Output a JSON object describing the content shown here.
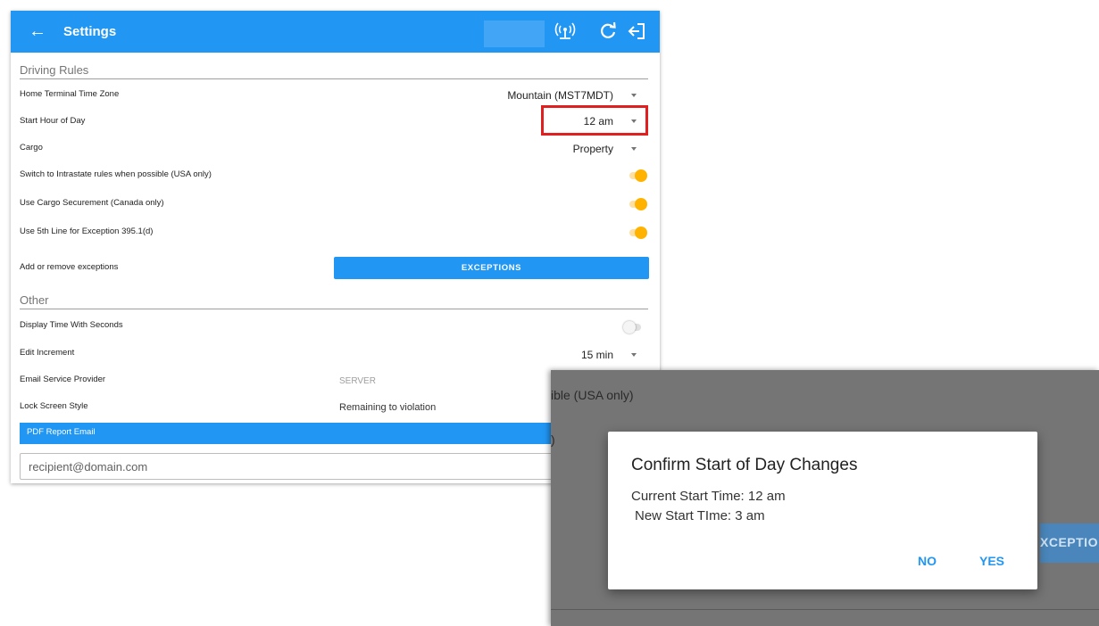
{
  "header": {
    "back_icon": "arrow-left-icon",
    "title": "Settings",
    "icons": [
      "antenna-icon",
      "refresh-icon",
      "logout-icon"
    ],
    "accent": "#2196f3"
  },
  "driving_rules": {
    "section_title": "Driving Rules",
    "home_terminal": {
      "label": "Home Terminal Time Zone",
      "value": "Mountain (MST7MDT)"
    },
    "start_hour": {
      "label": "Start Hour of Day",
      "value": "12 am"
    },
    "cargo": {
      "label": "Cargo",
      "value": "Property"
    },
    "intrastate": {
      "label": "Switch to Intrastate rules when possible (USA only)",
      "on": true
    },
    "cargo_securement": {
      "label": "Use Cargo Securement (Canada only)",
      "on": true
    },
    "fifth_line": {
      "label": "Use 5th Line for Exception 395.1(d)",
      "on": true
    },
    "exceptions": {
      "label": "Add or remove exceptions",
      "button": "EXCEPTIONS"
    }
  },
  "other": {
    "section_title": "Other",
    "display_seconds": {
      "label": "Display Time With Seconds",
      "on": false
    },
    "edit_increment": {
      "label": "Edit Increment",
      "value": "15 min"
    },
    "email_provider": {
      "label": "Email Service Provider",
      "value": "SERVER"
    },
    "lock_screen": {
      "label": "Lock Screen Style",
      "value": "Remaining to violation"
    },
    "pdf_email": {
      "label": "PDF Report Email",
      "placeholder": "recipient@domain.com"
    }
  },
  "overlay": {
    "bg_text1": "ible (USA only)",
    "bg_text2": ")",
    "bg_button": "XCEPTIO",
    "dialog": {
      "title": "Confirm Start of Day Changes",
      "current": "Current Start Time: 12 am",
      "new": "New Start TIme: 3 am",
      "no": "NO",
      "yes": "YES"
    }
  },
  "colors": {
    "highlight": "#e02020",
    "toggle_on": "#ffb300"
  }
}
